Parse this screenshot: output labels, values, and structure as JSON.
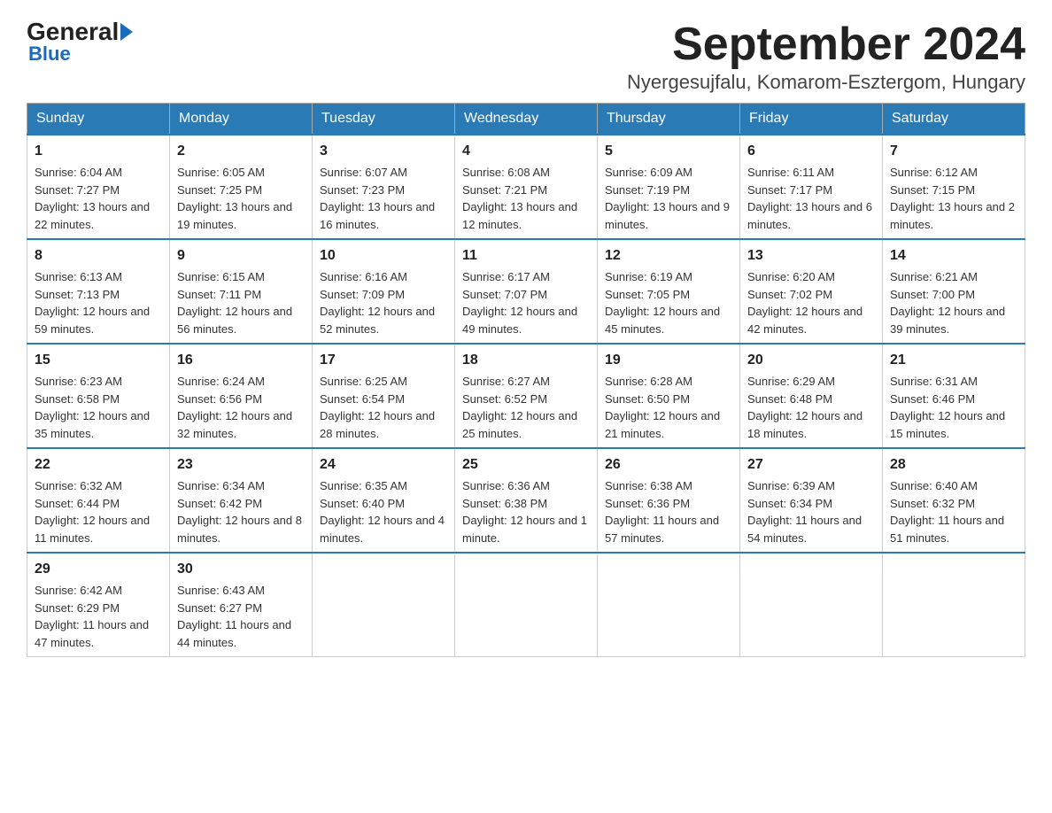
{
  "logo": {
    "general": "General",
    "blue": "Blue",
    "subtitle": "Blue"
  },
  "header": {
    "month_title": "September 2024",
    "location": "Nyergesujfalu, Komarom-Esztergom, Hungary"
  },
  "days_of_week": [
    "Sunday",
    "Monday",
    "Tuesday",
    "Wednesday",
    "Thursday",
    "Friday",
    "Saturday"
  ],
  "weeks": [
    [
      {
        "day": "1",
        "sunrise": "6:04 AM",
        "sunset": "7:27 PM",
        "daylight": "13 hours and 22 minutes."
      },
      {
        "day": "2",
        "sunrise": "6:05 AM",
        "sunset": "7:25 PM",
        "daylight": "13 hours and 19 minutes."
      },
      {
        "day": "3",
        "sunrise": "6:07 AM",
        "sunset": "7:23 PM",
        "daylight": "13 hours and 16 minutes."
      },
      {
        "day": "4",
        "sunrise": "6:08 AM",
        "sunset": "7:21 PM",
        "daylight": "13 hours and 12 minutes."
      },
      {
        "day": "5",
        "sunrise": "6:09 AM",
        "sunset": "7:19 PM",
        "daylight": "13 hours and 9 minutes."
      },
      {
        "day": "6",
        "sunrise": "6:11 AM",
        "sunset": "7:17 PM",
        "daylight": "13 hours and 6 minutes."
      },
      {
        "day": "7",
        "sunrise": "6:12 AM",
        "sunset": "7:15 PM",
        "daylight": "13 hours and 2 minutes."
      }
    ],
    [
      {
        "day": "8",
        "sunrise": "6:13 AM",
        "sunset": "7:13 PM",
        "daylight": "12 hours and 59 minutes."
      },
      {
        "day": "9",
        "sunrise": "6:15 AM",
        "sunset": "7:11 PM",
        "daylight": "12 hours and 56 minutes."
      },
      {
        "day": "10",
        "sunrise": "6:16 AM",
        "sunset": "7:09 PM",
        "daylight": "12 hours and 52 minutes."
      },
      {
        "day": "11",
        "sunrise": "6:17 AM",
        "sunset": "7:07 PM",
        "daylight": "12 hours and 49 minutes."
      },
      {
        "day": "12",
        "sunrise": "6:19 AM",
        "sunset": "7:05 PM",
        "daylight": "12 hours and 45 minutes."
      },
      {
        "day": "13",
        "sunrise": "6:20 AM",
        "sunset": "7:02 PM",
        "daylight": "12 hours and 42 minutes."
      },
      {
        "day": "14",
        "sunrise": "6:21 AM",
        "sunset": "7:00 PM",
        "daylight": "12 hours and 39 minutes."
      }
    ],
    [
      {
        "day": "15",
        "sunrise": "6:23 AM",
        "sunset": "6:58 PM",
        "daylight": "12 hours and 35 minutes."
      },
      {
        "day": "16",
        "sunrise": "6:24 AM",
        "sunset": "6:56 PM",
        "daylight": "12 hours and 32 minutes."
      },
      {
        "day": "17",
        "sunrise": "6:25 AM",
        "sunset": "6:54 PM",
        "daylight": "12 hours and 28 minutes."
      },
      {
        "day": "18",
        "sunrise": "6:27 AM",
        "sunset": "6:52 PM",
        "daylight": "12 hours and 25 minutes."
      },
      {
        "day": "19",
        "sunrise": "6:28 AM",
        "sunset": "6:50 PM",
        "daylight": "12 hours and 21 minutes."
      },
      {
        "day": "20",
        "sunrise": "6:29 AM",
        "sunset": "6:48 PM",
        "daylight": "12 hours and 18 minutes."
      },
      {
        "day": "21",
        "sunrise": "6:31 AM",
        "sunset": "6:46 PM",
        "daylight": "12 hours and 15 minutes."
      }
    ],
    [
      {
        "day": "22",
        "sunrise": "6:32 AM",
        "sunset": "6:44 PM",
        "daylight": "12 hours and 11 minutes."
      },
      {
        "day": "23",
        "sunrise": "6:34 AM",
        "sunset": "6:42 PM",
        "daylight": "12 hours and 8 minutes."
      },
      {
        "day": "24",
        "sunrise": "6:35 AM",
        "sunset": "6:40 PM",
        "daylight": "12 hours and 4 minutes."
      },
      {
        "day": "25",
        "sunrise": "6:36 AM",
        "sunset": "6:38 PM",
        "daylight": "12 hours and 1 minute."
      },
      {
        "day": "26",
        "sunrise": "6:38 AM",
        "sunset": "6:36 PM",
        "daylight": "11 hours and 57 minutes."
      },
      {
        "day": "27",
        "sunrise": "6:39 AM",
        "sunset": "6:34 PM",
        "daylight": "11 hours and 54 minutes."
      },
      {
        "day": "28",
        "sunrise": "6:40 AM",
        "sunset": "6:32 PM",
        "daylight": "11 hours and 51 minutes."
      }
    ],
    [
      {
        "day": "29",
        "sunrise": "6:42 AM",
        "sunset": "6:29 PM",
        "daylight": "11 hours and 47 minutes."
      },
      {
        "day": "30",
        "sunrise": "6:43 AM",
        "sunset": "6:27 PM",
        "daylight": "11 hours and 44 minutes."
      },
      null,
      null,
      null,
      null,
      null
    ]
  ]
}
